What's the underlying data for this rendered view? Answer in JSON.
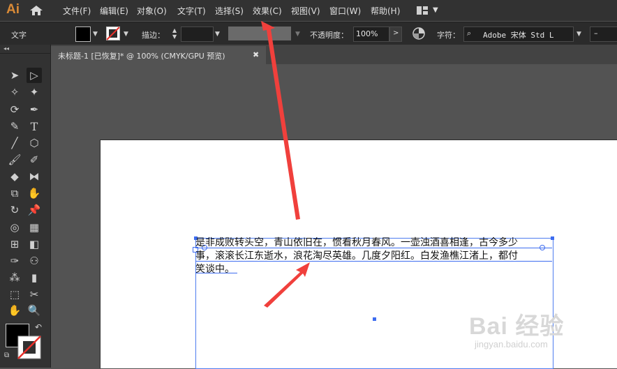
{
  "app": {
    "logo": "Ai"
  },
  "menu": {
    "items": [
      "文件(F)",
      "编辑(E)",
      "对象(O)",
      "文字(T)",
      "选择(S)",
      "效果(C)",
      "视图(V)",
      "窗口(W)",
      "帮助(H)"
    ]
  },
  "controlbar": {
    "tool_label": "文字",
    "stroke_label": "描边：",
    "opacity_label": "不透明度：",
    "opacity_value": "100%",
    "character_label": "字符：",
    "font_value": "Adobe 宋体 Std L",
    "font_style_value": "–"
  },
  "panel": {
    "collapse": "◂◂"
  },
  "document": {
    "tab_title": "未标题-1 [已恢复]* @ 100% (CMYK/GPU 预览)",
    "close": "✖",
    "text_lines": [
      "是非成败转头空，青山依旧在，惯看秋月春风。一壶浊酒喜相逢，古今多少",
      "事，滚滚长江东逝水，浪花淘尽英雄。几度夕阳红。白发渔樵江渚上，都付",
      "笑谈中。"
    ]
  },
  "watermark": {
    "main": "Bai 经验",
    "sub": "jingyan.baidu.com"
  },
  "colors": {
    "arrow": "#f0403c",
    "selection": "#3d6cf0",
    "accent": "#d98a37"
  }
}
